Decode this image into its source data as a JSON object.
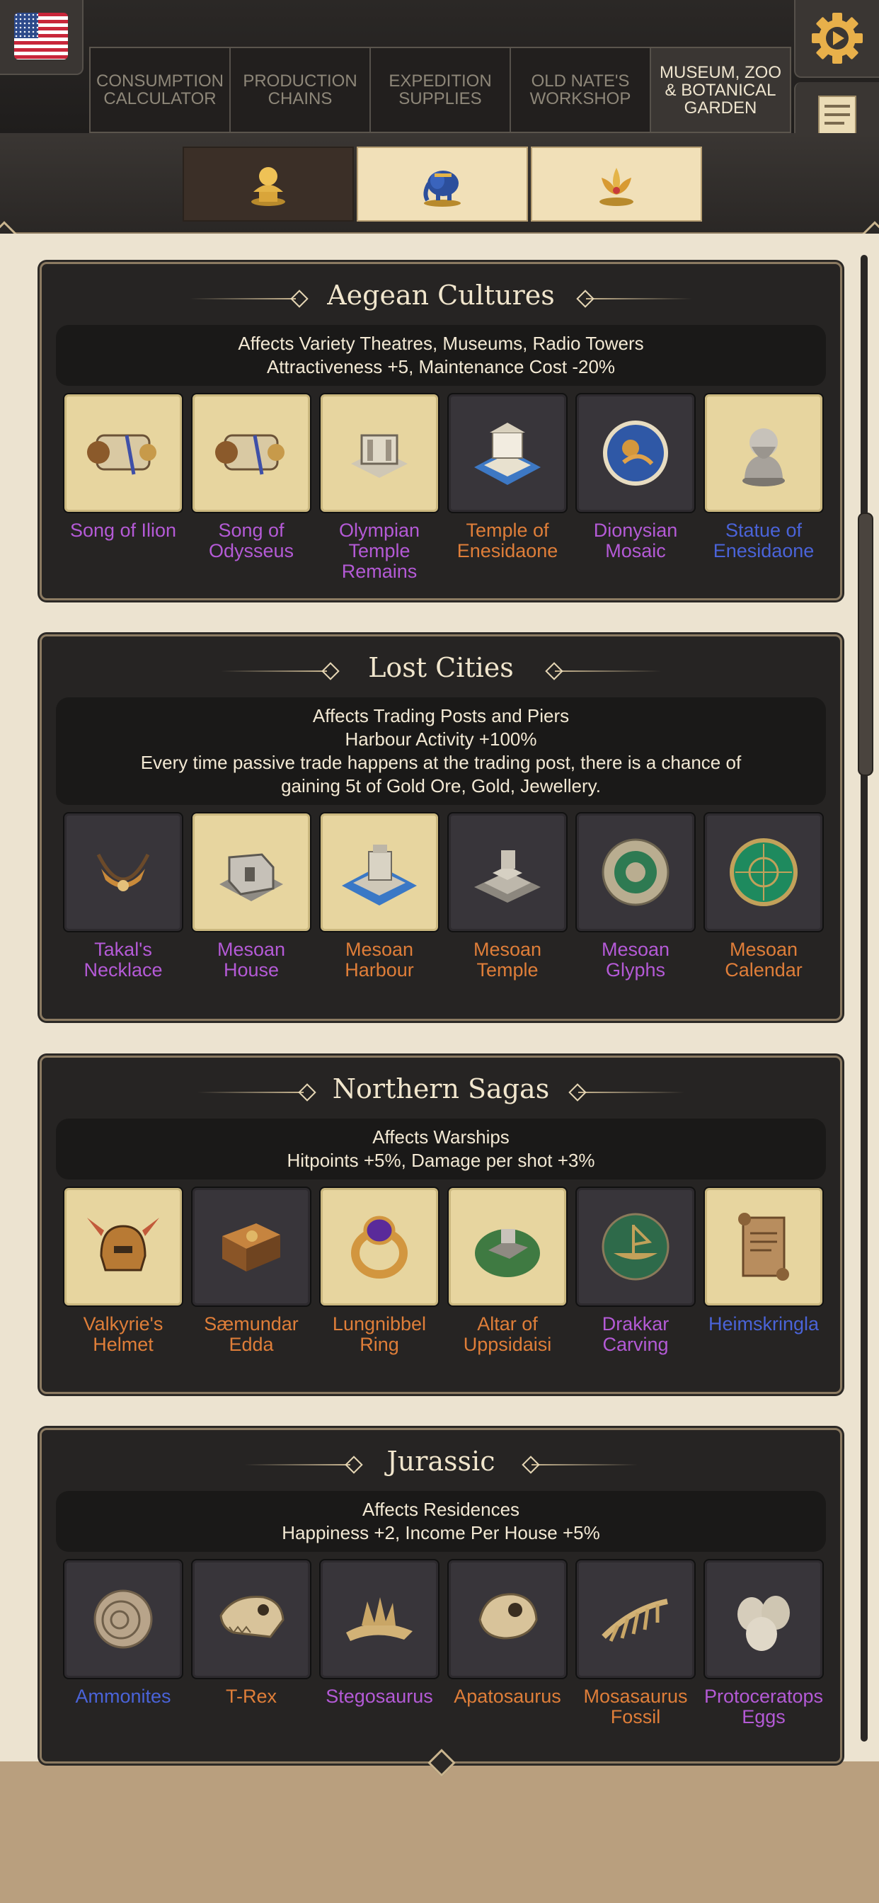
{
  "header": {
    "flag_icon": "us-flag-icon",
    "tabs": [
      {
        "label": "Consumption Calculator"
      },
      {
        "label": "Production Chains"
      },
      {
        "label": "Expedition Supplies"
      },
      {
        "label": "Old Nate's Workshop"
      },
      {
        "label": "Museum, Zoo & Botanical Garden"
      }
    ],
    "active_tab": "Museum, Zoo & Botanical Garden",
    "settings_icon": "gear-play-icon",
    "notes_icon": "notes-icon"
  },
  "subtabs": [
    {
      "icon": "bust-icon",
      "active": true
    },
    {
      "icon": "elephant-icon",
      "active": false
    },
    {
      "icon": "lotus-icon",
      "active": false
    }
  ],
  "colors": {
    "purple": "#b45ad6",
    "orange": "#df7e39",
    "blue": "#4a63d8",
    "owned_bg": "#e7d59f",
    "missing_bg": "#38353a"
  },
  "sets": [
    {
      "title": "Aegean Cultures",
      "effects": [
        "Affects Variety Theatres, Museums, Radio Towers",
        "Attractiveness +5, Maintenance Cost -20%"
      ],
      "items": [
        {
          "name": "Song of Ilion",
          "icon": "scroll-icon",
          "owned": true,
          "color": "purple"
        },
        {
          "name": "Song of Odysseus",
          "icon": "scroll-icon",
          "owned": true,
          "color": "purple"
        },
        {
          "name": "Olympian Temple Remains",
          "icon": "temple-ruins-icon",
          "owned": true,
          "color": "purple"
        },
        {
          "name": "Temple of Enesidaone",
          "icon": "temple-icon",
          "owned": false,
          "color": "orange"
        },
        {
          "name": "Dionysian Mosaic",
          "icon": "mosaic-icon",
          "owned": false,
          "color": "purple"
        },
        {
          "name": "Statue of Enesidaone",
          "icon": "statue-icon",
          "owned": true,
          "color": "blue"
        }
      ]
    },
    {
      "title": "Lost Cities",
      "effects": [
        "Affects Trading Posts and Piers",
        "Harbour Activity +100%",
        "Every time passive trade happens at the trading post, there is a chance of",
        "gaining 5t of Gold Ore, Gold, Jewellery."
      ],
      "items": [
        {
          "name": "Takal's Necklace",
          "icon": "necklace-icon",
          "owned": false,
          "color": "purple"
        },
        {
          "name": "Mesoan House",
          "icon": "house-ruin-icon",
          "owned": true,
          "color": "purple"
        },
        {
          "name": "Mesoan Harbour",
          "icon": "harbour-icon",
          "owned": true,
          "color": "orange"
        },
        {
          "name": "Mesoan Temple",
          "icon": "pyramid-temple-icon",
          "owned": false,
          "color": "orange"
        },
        {
          "name": "Mesoan Glyphs",
          "icon": "glyph-disc-icon",
          "owned": false,
          "color": "purple"
        },
        {
          "name": "Mesoan Calendar",
          "icon": "calendar-disc-icon",
          "owned": false,
          "color": "orange"
        }
      ]
    },
    {
      "title": "Northern Sagas",
      "effects": [
        "Affects Warships",
        "Hitpoints +5%, Damage per shot +3%"
      ],
      "items": [
        {
          "name": "Valkyrie's Helmet",
          "icon": "helmet-icon",
          "owned": true,
          "color": "orange"
        },
        {
          "name": "Sæmundar Edda",
          "icon": "book-icon",
          "owned": false,
          "color": "orange"
        },
        {
          "name": "Lungnibbel Ring",
          "icon": "ring-icon",
          "owned": true,
          "color": "orange"
        },
        {
          "name": "Altar of Uppsidaisi",
          "icon": "altar-icon",
          "owned": true,
          "color": "orange"
        },
        {
          "name": "Drakkar Carving",
          "icon": "ship-carving-icon",
          "owned": false,
          "color": "purple"
        },
        {
          "name": "Heimskringla",
          "icon": "parchment-icon",
          "owned": true,
          "color": "blue"
        }
      ]
    },
    {
      "title": "Jurassic",
      "effects": [
        "Affects Residences",
        "Happiness +2, Income Per House +5%"
      ],
      "items": [
        {
          "name": "Ammonites",
          "icon": "ammonite-icon",
          "owned": false,
          "color": "blue"
        },
        {
          "name": "T-Rex",
          "icon": "trex-skull-icon",
          "owned": false,
          "color": "orange"
        },
        {
          "name": "Stegosaurus",
          "icon": "stegosaurus-icon",
          "owned": false,
          "color": "purple"
        },
        {
          "name": "Apatosaurus",
          "icon": "dino-skull-icon",
          "owned": false,
          "color": "orange"
        },
        {
          "name": "Mosasaurus Fossil",
          "icon": "fossil-icon",
          "owned": false,
          "color": "orange"
        },
        {
          "name": "Protoceratops Eggs",
          "icon": "eggs-icon",
          "owned": false,
          "color": "purple"
        }
      ]
    }
  ]
}
